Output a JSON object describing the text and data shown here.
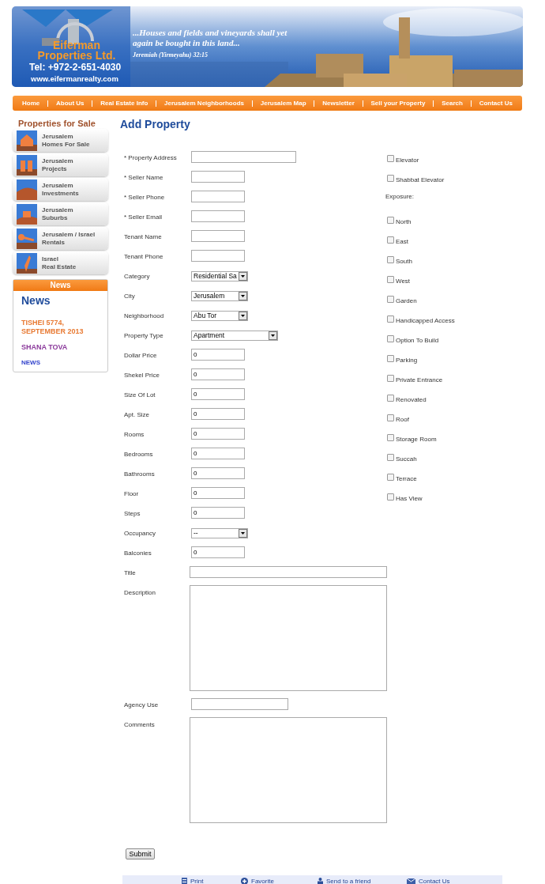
{
  "header": {
    "company": "Eiferman Properties Ltd.",
    "phone": "Tel: +972-2-651-4030",
    "website": "www.eifermanrealty.com",
    "quote": "...Houses and fields and vineyards shall yet again be bought in this land...",
    "quote_source": "Jeremiah (Yirmeyahu) 32:15"
  },
  "nav": [
    "Home",
    "About Us",
    "Real Estate Info",
    "Jerusalem Neighborhoods",
    "Jerusalem Map",
    "Newsletter",
    "Sell your Property",
    "Search",
    "Contact Us"
  ],
  "sidebar": {
    "title": "Properties for Sale",
    "items": [
      {
        "line1": "Jerusalem",
        "line2": "Homes For Sale",
        "kind": "house"
      },
      {
        "line1": "Jerusalem",
        "line2": "Projects",
        "kind": "towers"
      },
      {
        "line1": "Jerusalem",
        "line2": "Investments",
        "kind": "hills"
      },
      {
        "line1": "Jerusalem",
        "line2": "Suburbs",
        "kind": "village"
      },
      {
        "line1": "Jerusalem / Israel",
        "line2": "Rentals",
        "kind": "key"
      },
      {
        "line1": "Israel",
        "line2": "Real Estate",
        "kind": "map"
      }
    ]
  },
  "news": {
    "header": "News",
    "heading": "News",
    "date": "TISHEI 5774, SEPTEMBER 2013",
    "item": "SHANA TOVA",
    "link": "NEWS"
  },
  "page_title": "Add Property",
  "fields": [
    {
      "label": "* Property Address",
      "kind": "longtext"
    },
    {
      "label": "* Seller Name",
      "kind": "text"
    },
    {
      "label": "* Seller Phone",
      "kind": "text"
    },
    {
      "label": "* Seller Email",
      "kind": "text"
    },
    {
      "label": "Tenant Name",
      "kind": "text"
    },
    {
      "label": "Tenant Phone",
      "kind": "text"
    },
    {
      "label": "Category",
      "kind": "select",
      "value": "Residential Sa"
    },
    {
      "label": "City",
      "kind": "select",
      "value": "Jerusalem"
    },
    {
      "label": "Neighborhood",
      "kind": "select",
      "value": "Abu Tor"
    },
    {
      "label": "Property Type",
      "kind": "wideselect",
      "value": "Apartment"
    },
    {
      "label": "Dollar Price",
      "kind": "text",
      "value": "0"
    },
    {
      "label": "Shekel Price",
      "kind": "text",
      "value": "0"
    },
    {
      "label": "Size Of Lot",
      "kind": "text",
      "value": "0"
    },
    {
      "label": "Apt. Size",
      "kind": "text",
      "value": "0"
    },
    {
      "label": "Rooms",
      "kind": "text",
      "value": "0"
    },
    {
      "label": "Bedrooms",
      "kind": "text",
      "value": "0"
    },
    {
      "label": "Bathrooms",
      "kind": "text",
      "value": "0"
    },
    {
      "label": "Floor",
      "kind": "text",
      "value": "0"
    },
    {
      "label": "Steps",
      "kind": "text",
      "value": "0"
    },
    {
      "label": "Occupancy",
      "kind": "select",
      "value": "--"
    },
    {
      "label": "Balconies",
      "kind": "text",
      "value": "0"
    },
    {
      "label": "Title",
      "kind": "widetext"
    },
    {
      "label": "Description",
      "kind": "textarea"
    },
    {
      "label": "Agency Use",
      "kind": "mediumtext"
    },
    {
      "label": "Comments",
      "kind": "textarea"
    }
  ],
  "options": [
    {
      "kind": "checkbox",
      "label": "Elevator",
      "checked": false
    },
    {
      "kind": "checkbox",
      "label": "Shabbat Elevator",
      "checked": false
    },
    {
      "kind": "heading",
      "label": "Exposure:"
    },
    {
      "kind": "checkbox",
      "label": "North",
      "checked": false
    },
    {
      "kind": "checkbox",
      "label": "East",
      "checked": false
    },
    {
      "kind": "checkbox",
      "label": "South",
      "checked": false
    },
    {
      "kind": "checkbox",
      "label": "West",
      "checked": false
    },
    {
      "kind": "checkbox",
      "label": "Garden",
      "checked": false
    },
    {
      "kind": "checkbox",
      "label": "Handicapped Access",
      "checked": false
    },
    {
      "kind": "checkbox",
      "label": "Option To Build",
      "checked": false
    },
    {
      "kind": "checkbox",
      "label": "Parking",
      "checked": false
    },
    {
      "kind": "checkbox",
      "label": "Private Entrance",
      "checked": false
    },
    {
      "kind": "checkbox",
      "label": "Renovated",
      "checked": false
    },
    {
      "kind": "checkbox",
      "label": "Roof",
      "checked": false
    },
    {
      "kind": "checkbox",
      "label": "Storage Room",
      "checked": false
    },
    {
      "kind": "checkbox",
      "label": "Succah",
      "checked": false
    },
    {
      "kind": "checkbox",
      "label": "Terrace",
      "checked": false
    },
    {
      "kind": "checkbox",
      "label": "Has View",
      "checked": false
    }
  ],
  "submit": "Submit",
  "footer": [
    {
      "label": "Print",
      "kind": "print"
    },
    {
      "label": "Favorite",
      "kind": "favorite"
    },
    {
      "label": "Send to a friend",
      "kind": "send"
    },
    {
      "label": "Contact Us",
      "kind": "contact"
    }
  ]
}
